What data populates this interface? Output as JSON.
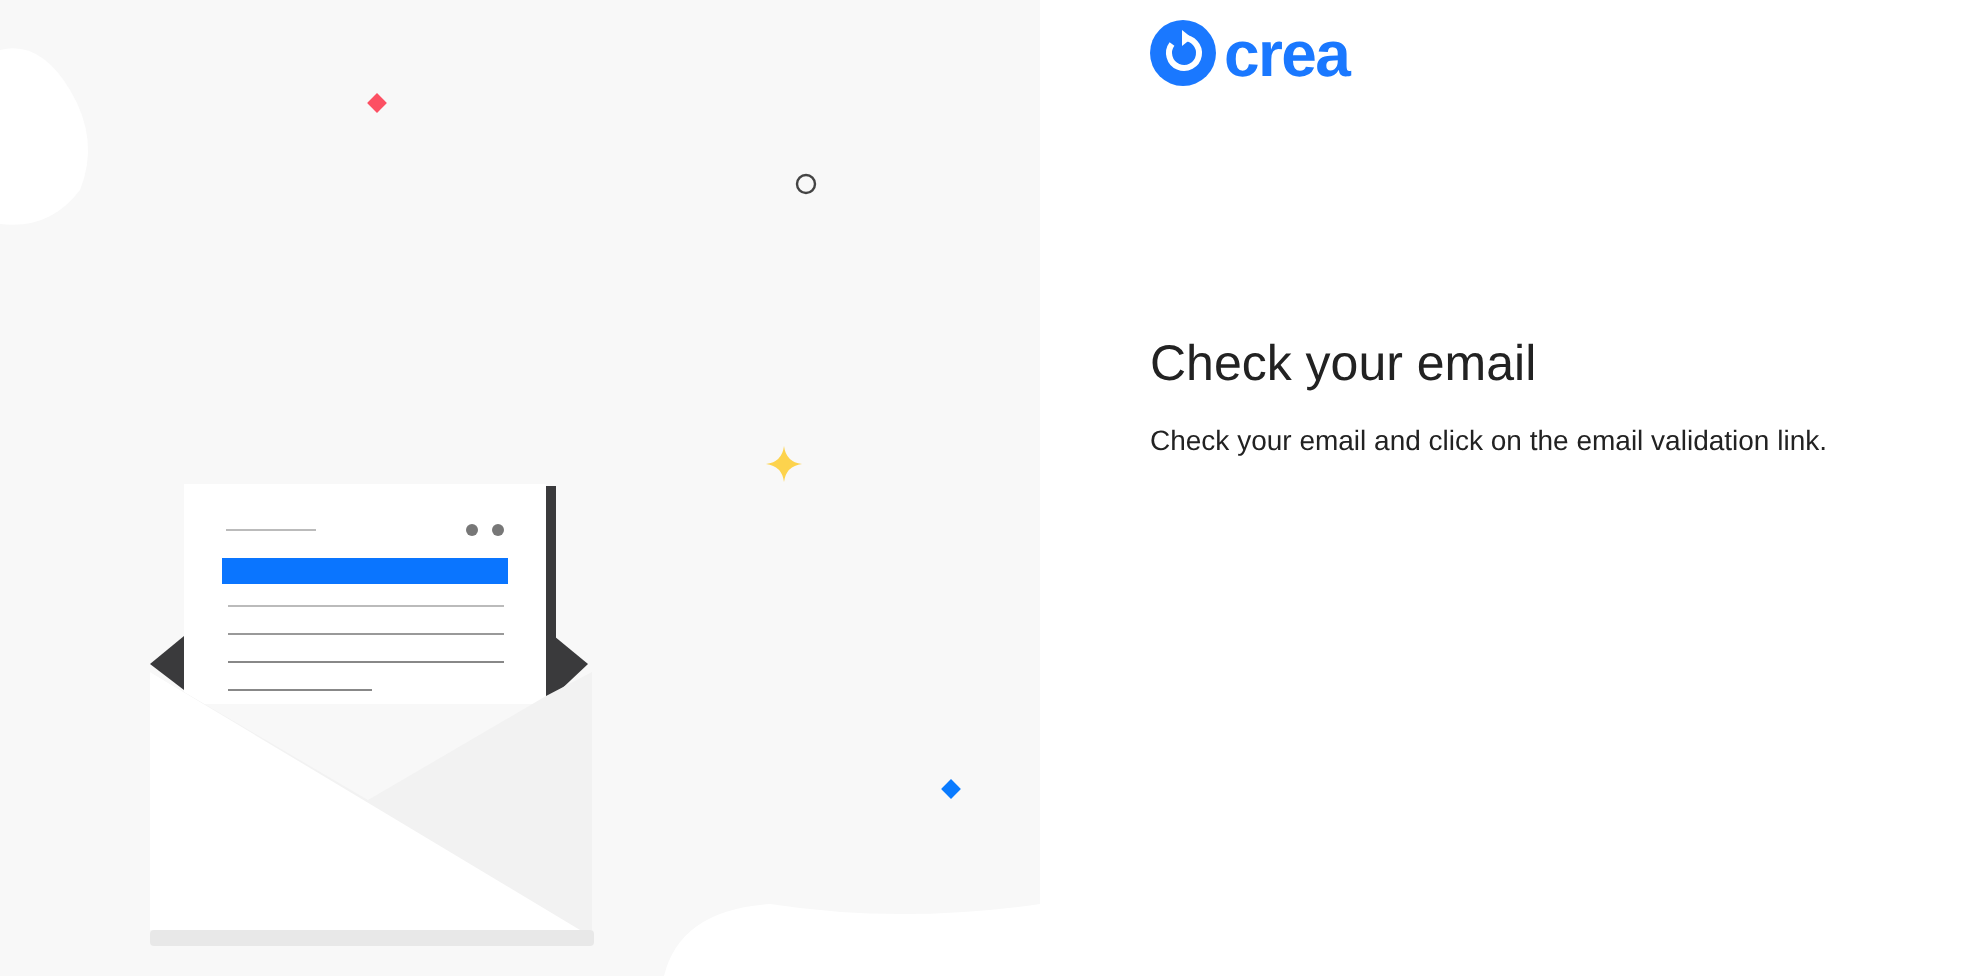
{
  "logo": {
    "text": "crea"
  },
  "heading": "Check your email",
  "message": "Check your email and click on the email validation link."
}
